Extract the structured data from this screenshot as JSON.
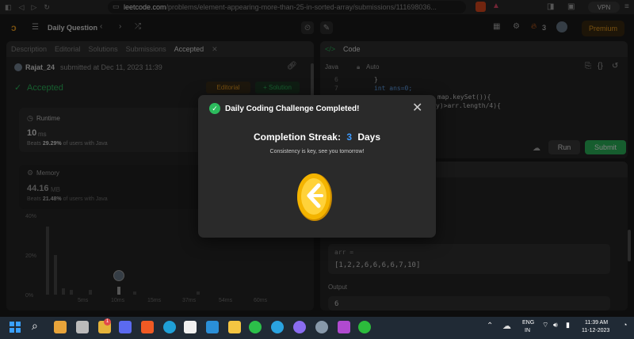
{
  "browser": {
    "url_domain": "leetcode.com",
    "url_path": "/problems/element-appearing-more-than-25-in-sorted-array/submissions/111698036...",
    "vpn_label": "VPN"
  },
  "topbar": {
    "title": "Daily Question",
    "streak_count": "3",
    "premium_label": "Premium"
  },
  "left_panel": {
    "tabs": [
      "Description",
      "Editorial",
      "Solutions",
      "Submissions",
      "Accepted"
    ],
    "submitter": "Rajat_24",
    "submitted_text": "submitted at Dec 11, 2023 11:39",
    "status": "Accepted",
    "editorial_btn": "Editorial",
    "solution_btn": "+ Solution",
    "runtime": {
      "label": "Runtime",
      "value": "10",
      "unit": "ms",
      "beats_prefix": "Beats",
      "beats_pct": "29.29%",
      "beats_suffix": "of users with Java"
    },
    "memory": {
      "label": "Memory",
      "value": "44.16",
      "unit": "MB",
      "beats_prefix": "Beats",
      "beats_pct": "21.48%",
      "beats_suffix": "of users with Java"
    },
    "chart_y": [
      "40%",
      "20%",
      "0%"
    ],
    "chart_x": [
      "5ms",
      "10ms",
      "15ms",
      "37ms",
      "54ms",
      "60ms"
    ]
  },
  "right_panel": {
    "title": "Code",
    "language": "Java",
    "auto": "Auto",
    "line_numbers": [
      "6",
      "7"
    ],
    "code_lines": [
      "}",
      "int ans=0;",
      "map.keySet()){",
      "y)>arr.length/4){"
    ],
    "run_btn": "Run",
    "submit_btn": "Submit",
    "input_label": "arr =",
    "input_value": "[1,2,2,6,6,6,6,7,10]",
    "output_label": "Output",
    "output_value": "6"
  },
  "modal": {
    "title": "Daily Coding Challenge Completed!",
    "streak_prefix": "Completion Streak:",
    "streak_value": "3",
    "streak_suffix": "Days",
    "message": "Consistency is key, see you tomorrow!"
  },
  "taskbar": {
    "lang_top": "ENG",
    "lang_bottom": "IN",
    "time": "11:39 AM",
    "date": "11-12-2023",
    "notif_count": "1"
  },
  "colors": {
    "accent_green": "#2cbb5d",
    "accent_blue": "#3e9bff",
    "coin_gold": "#f4b400"
  }
}
